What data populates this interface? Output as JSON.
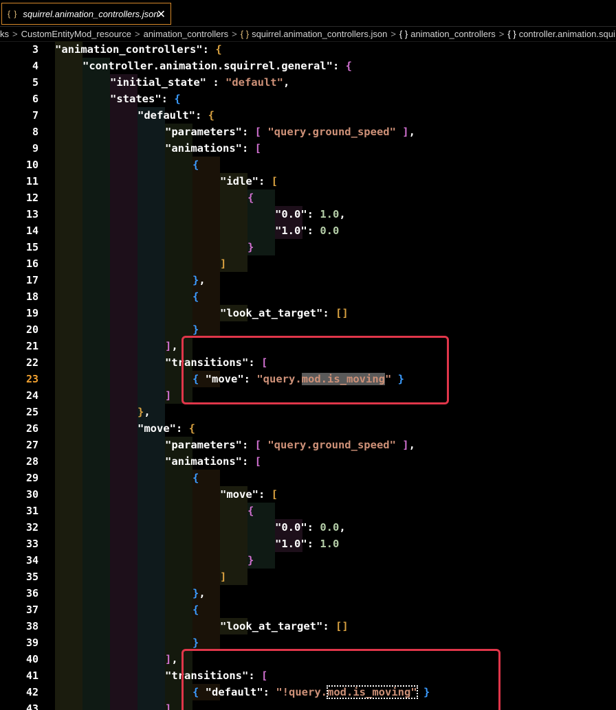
{
  "tab": {
    "icon": "{ }",
    "filename": "squirrel.animation_controllers.json",
    "close": "✕"
  },
  "breadcrumb": [
    {
      "label": "ks",
      "icon": ""
    },
    {
      "label": "CustomEntityMod_resource",
      "icon": ""
    },
    {
      "label": "animation_controllers",
      "icon": ""
    },
    {
      "label": "squirrel.animation_controllers.json",
      "icon": "{ }"
    },
    {
      "label": "animation_controllers",
      "icon": "{ }"
    },
    {
      "label": "controller.animation.squi",
      "icon": "{ }"
    }
  ],
  "active_line": 23,
  "lines": [
    {
      "n": 3,
      "depth": 2,
      "code": [
        [
          "k",
          "\"animation_controllers\""
        ],
        [
          "p",
          ": "
        ],
        [
          "b1",
          "{"
        ]
      ]
    },
    {
      "n": 4,
      "depth": 3,
      "code": [
        [
          "k",
          "\"controller.animation.squirrel.general\""
        ],
        [
          "p",
          ": "
        ],
        [
          "b2",
          "{"
        ]
      ]
    },
    {
      "n": 5,
      "depth": 4,
      "code": [
        [
          "k",
          "\"initial_state\""
        ],
        [
          "p",
          " : "
        ],
        [
          "s",
          "\"default\""
        ],
        [
          "p",
          ","
        ]
      ]
    },
    {
      "n": 6,
      "depth": 4,
      "code": [
        [
          "k",
          "\"states\""
        ],
        [
          "p",
          ": "
        ],
        [
          "b3",
          "{"
        ]
      ]
    },
    {
      "n": 7,
      "depth": 5,
      "code": [
        [
          "k",
          "\"default\""
        ],
        [
          "p",
          ": "
        ],
        [
          "b1",
          "{"
        ]
      ]
    },
    {
      "n": 8,
      "depth": 6,
      "code": [
        [
          "k",
          "\"parameters\""
        ],
        [
          "p",
          ": "
        ],
        [
          "b2",
          "[ "
        ],
        [
          "s",
          "\"query.ground_speed\""
        ],
        [
          "b2",
          " ]"
        ],
        [
          "p",
          ","
        ]
      ]
    },
    {
      "n": 9,
      "depth": 6,
      "code": [
        [
          "k",
          "\"animations\""
        ],
        [
          "p",
          ": "
        ],
        [
          "b2",
          "["
        ]
      ]
    },
    {
      "n": 10,
      "depth": 7,
      "code": [
        [
          "b3",
          "{"
        ]
      ]
    },
    {
      "n": 11,
      "depth": 8,
      "code": [
        [
          "k",
          "\"idle\""
        ],
        [
          "p",
          ": "
        ],
        [
          "b1",
          "["
        ]
      ]
    },
    {
      "n": 12,
      "depth": 9,
      "code": [
        [
          "b2",
          "{"
        ]
      ]
    },
    {
      "n": 13,
      "depth": 10,
      "code": [
        [
          "k",
          "\"0.0\""
        ],
        [
          "p",
          ": "
        ],
        [
          "n",
          "1.0"
        ],
        [
          "p",
          ","
        ]
      ]
    },
    {
      "n": 14,
      "depth": 10,
      "code": [
        [
          "k",
          "\"1.0\""
        ],
        [
          "p",
          ": "
        ],
        [
          "n",
          "0.0"
        ]
      ]
    },
    {
      "n": 15,
      "depth": 9,
      "code": [
        [
          "b2",
          "}"
        ]
      ]
    },
    {
      "n": 16,
      "depth": 8,
      "code": [
        [
          "b1",
          "]"
        ]
      ]
    },
    {
      "n": 17,
      "depth": 7,
      "code": [
        [
          "b3",
          "}"
        ],
        [
          "p",
          ","
        ]
      ]
    },
    {
      "n": 18,
      "depth": 7,
      "code": [
        [
          "b3",
          "{"
        ]
      ]
    },
    {
      "n": 19,
      "depth": 8,
      "code": [
        [
          "k",
          "\"look_at_target\""
        ],
        [
          "p",
          ": "
        ],
        [
          "b1",
          "[]"
        ]
      ]
    },
    {
      "n": 20,
      "depth": 7,
      "code": [
        [
          "b3",
          "}"
        ]
      ]
    },
    {
      "n": 21,
      "depth": 6,
      "code": [
        [
          "b2",
          "]"
        ],
        [
          "p",
          ","
        ]
      ]
    },
    {
      "n": 22,
      "depth": 6,
      "code": [
        [
          "k",
          "\"transitions\""
        ],
        [
          "p",
          ": "
        ],
        [
          "b2",
          "["
        ]
      ]
    },
    {
      "n": 23,
      "depth": 7,
      "code": [
        [
          "b3",
          "{ "
        ],
        [
          "k",
          "\"move\""
        ],
        [
          "p",
          ": "
        ],
        [
          "s",
          "\"query."
        ],
        [
          "shl",
          "mod.is_moving"
        ],
        [
          "s",
          "\""
        ],
        [
          "b3",
          " }"
        ]
      ]
    },
    {
      "n": 24,
      "depth": 6,
      "code": [
        [
          "b2",
          "]"
        ]
      ]
    },
    {
      "n": 25,
      "depth": 5,
      "code": [
        [
          "b1",
          "}"
        ],
        [
          "p",
          ","
        ]
      ]
    },
    {
      "n": 26,
      "depth": 5,
      "code": [
        [
          "k",
          "\"move\""
        ],
        [
          "p",
          ": "
        ],
        [
          "b1",
          "{"
        ]
      ]
    },
    {
      "n": 27,
      "depth": 6,
      "code": [
        [
          "k",
          "\"parameters\""
        ],
        [
          "p",
          ": "
        ],
        [
          "b2",
          "[ "
        ],
        [
          "s",
          "\"query.ground_speed\""
        ],
        [
          "b2",
          " ]"
        ],
        [
          "p",
          ","
        ]
      ]
    },
    {
      "n": 28,
      "depth": 6,
      "code": [
        [
          "k",
          "\"animations\""
        ],
        [
          "p",
          ": "
        ],
        [
          "b2",
          "["
        ]
      ]
    },
    {
      "n": 29,
      "depth": 7,
      "code": [
        [
          "b3",
          "{"
        ]
      ]
    },
    {
      "n": 30,
      "depth": 8,
      "code": [
        [
          "k",
          "\"move\""
        ],
        [
          "p",
          ": "
        ],
        [
          "b1",
          "["
        ]
      ]
    },
    {
      "n": 31,
      "depth": 9,
      "code": [
        [
          "b2",
          "{"
        ]
      ]
    },
    {
      "n": 32,
      "depth": 10,
      "code": [
        [
          "k",
          "\"0.0\""
        ],
        [
          "p",
          ": "
        ],
        [
          "n",
          "0.0"
        ],
        [
          "p",
          ","
        ]
      ]
    },
    {
      "n": 33,
      "depth": 10,
      "code": [
        [
          "k",
          "\"1.0\""
        ],
        [
          "p",
          ": "
        ],
        [
          "n",
          "1.0"
        ]
      ]
    },
    {
      "n": 34,
      "depth": 9,
      "code": [
        [
          "b2",
          "}"
        ]
      ]
    },
    {
      "n": 35,
      "depth": 8,
      "code": [
        [
          "b1",
          "]"
        ]
      ]
    },
    {
      "n": 36,
      "depth": 7,
      "code": [
        [
          "b3",
          "}"
        ],
        [
          "p",
          ","
        ]
      ]
    },
    {
      "n": 37,
      "depth": 7,
      "code": [
        [
          "b3",
          "{"
        ]
      ]
    },
    {
      "n": 38,
      "depth": 8,
      "code": [
        [
          "k",
          "\"look_at_target\""
        ],
        [
          "p",
          ": "
        ],
        [
          "b1",
          "[]"
        ]
      ]
    },
    {
      "n": 39,
      "depth": 7,
      "code": [
        [
          "b3",
          "}"
        ]
      ]
    },
    {
      "n": 40,
      "depth": 6,
      "code": [
        [
          "b2",
          "]"
        ],
        [
          "p",
          ","
        ]
      ]
    },
    {
      "n": 41,
      "depth": 6,
      "code": [
        [
          "k",
          "\"transitions\""
        ],
        [
          "p",
          ": "
        ],
        [
          "b2",
          "["
        ]
      ]
    },
    {
      "n": 42,
      "depth": 7,
      "code": [
        [
          "b3",
          "{ "
        ],
        [
          "k",
          "\"default\""
        ],
        [
          "p",
          ": "
        ],
        [
          "s",
          "\"!query."
        ],
        [
          "sdot",
          "mod.is_moving\""
        ],
        [
          "b3",
          " }"
        ]
      ]
    },
    {
      "n": 43,
      "depth": 6,
      "code": [
        [
          "b2",
          "]"
        ]
      ]
    }
  ],
  "colors": {
    "highlight_box": "#e0364a",
    "active_line_number": "#f0a030",
    "string": "#ce9178",
    "number": "#b5cea8"
  }
}
